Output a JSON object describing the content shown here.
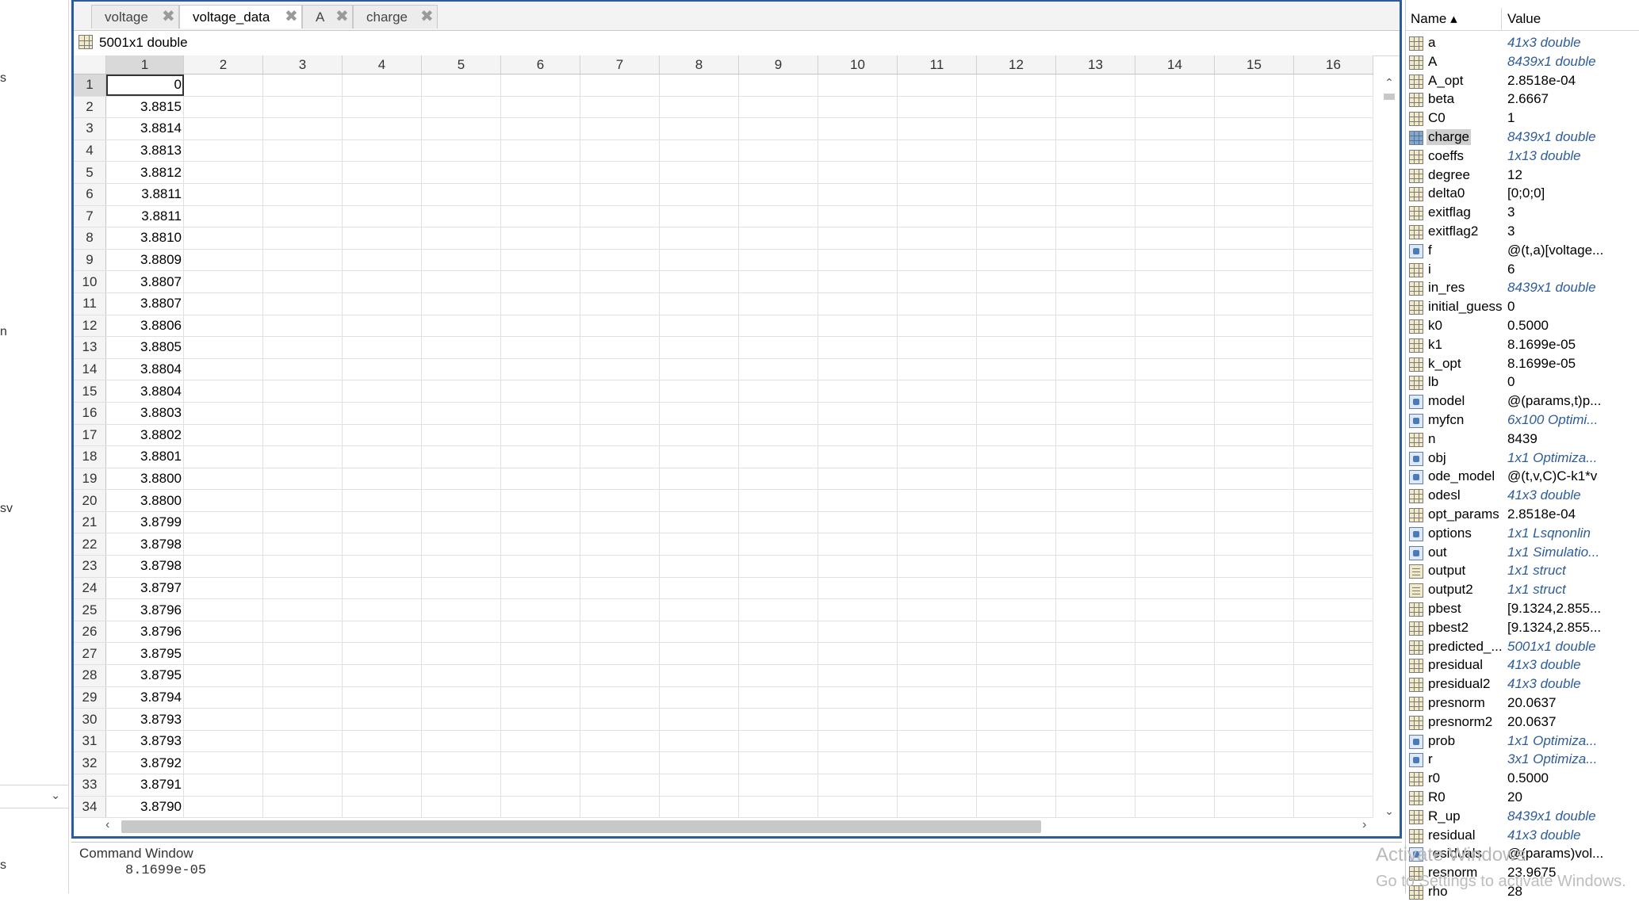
{
  "left_panel": {
    "fragments": [
      "s",
      "n",
      "sv",
      "s"
    ]
  },
  "tabs": [
    {
      "label": "voltage",
      "active": false
    },
    {
      "label": "voltage_data",
      "active": true
    },
    {
      "label": "A",
      "active": false
    },
    {
      "label": "charge",
      "active": false
    }
  ],
  "variable_info": "5001x1 double",
  "grid": {
    "columns": [
      "1",
      "2",
      "3",
      "4",
      "5",
      "6",
      "7",
      "8",
      "9",
      "10",
      "11",
      "12",
      "13",
      "14",
      "15",
      "16"
    ],
    "rows": [
      "1",
      "2",
      "3",
      "4",
      "5",
      "6",
      "7",
      "8",
      "9",
      "10",
      "11",
      "12",
      "13",
      "14",
      "15",
      "16",
      "17",
      "18",
      "19",
      "20",
      "21",
      "22",
      "23",
      "24",
      "25",
      "26",
      "27",
      "28",
      "29",
      "30",
      "31",
      "32",
      "33",
      "34"
    ],
    "values": [
      "0",
      "3.8815",
      "3.8814",
      "3.8813",
      "3.8812",
      "3.8811",
      "3.8811",
      "3.8810",
      "3.8809",
      "3.8807",
      "3.8807",
      "3.8806",
      "3.8805",
      "3.8804",
      "3.8804",
      "3.8803",
      "3.8802",
      "3.8801",
      "3.8800",
      "3.8800",
      "3.8799",
      "3.8798",
      "3.8798",
      "3.8797",
      "3.8796",
      "3.8796",
      "3.8795",
      "3.8795",
      "3.8794",
      "3.8793",
      "3.8793",
      "3.8792",
      "3.8791",
      "3.8790"
    ]
  },
  "command_window": {
    "title": "Command Window",
    "output": "8.1699e-05"
  },
  "workspace": {
    "header_name": "Name ▴",
    "header_value": "Value",
    "variables": [
      {
        "name": "a",
        "value": "41x3 double",
        "italic": true,
        "icon": "matrix"
      },
      {
        "name": "A",
        "value": "8439x1 double",
        "italic": true,
        "icon": "matrix"
      },
      {
        "name": "A_opt",
        "value": "2.8518e-04",
        "italic": false,
        "icon": "matrix"
      },
      {
        "name": "beta",
        "value": "2.6667",
        "italic": false,
        "icon": "matrix"
      },
      {
        "name": "C0",
        "value": "1",
        "italic": false,
        "icon": "matrix"
      },
      {
        "name": "charge",
        "value": "8439x1 double",
        "italic": true,
        "icon": "matrixsel",
        "selected": true
      },
      {
        "name": "coeffs",
        "value": "1x13 double",
        "italic": true,
        "icon": "matrix"
      },
      {
        "name": "degree",
        "value": "12",
        "italic": false,
        "icon": "matrix"
      },
      {
        "name": "delta0",
        "value": "[0;0;0]",
        "italic": false,
        "icon": "matrix"
      },
      {
        "name": "exitflag",
        "value": "3",
        "italic": false,
        "icon": "matrix"
      },
      {
        "name": "exitflag2",
        "value": "3",
        "italic": false,
        "icon": "matrix"
      },
      {
        "name": "f",
        "value": "@(t,a)[voltage...",
        "italic": false,
        "icon": "object"
      },
      {
        "name": "i",
        "value": "6",
        "italic": false,
        "icon": "matrix"
      },
      {
        "name": "in_res",
        "value": "8439x1 double",
        "italic": true,
        "icon": "matrix"
      },
      {
        "name": "initial_guess",
        "value": "0",
        "italic": false,
        "icon": "matrix"
      },
      {
        "name": "k0",
        "value": "0.5000",
        "italic": false,
        "icon": "matrix"
      },
      {
        "name": "k1",
        "value": "8.1699e-05",
        "italic": false,
        "icon": "matrix"
      },
      {
        "name": "k_opt",
        "value": "8.1699e-05",
        "italic": false,
        "icon": "matrix"
      },
      {
        "name": "lb",
        "value": "0",
        "italic": false,
        "icon": "matrix"
      },
      {
        "name": "model",
        "value": "@(params,t)p...",
        "italic": false,
        "icon": "object"
      },
      {
        "name": "myfcn",
        "value": "6x100 Optimi...",
        "italic": true,
        "icon": "object"
      },
      {
        "name": "n",
        "value": "8439",
        "italic": false,
        "icon": "matrix"
      },
      {
        "name": "obj",
        "value": "1x1 Optimiza...",
        "italic": true,
        "icon": "object"
      },
      {
        "name": "ode_model",
        "value": "@(t,v,C)C-k1*v",
        "italic": false,
        "icon": "object"
      },
      {
        "name": "odesl",
        "value": "41x3 double",
        "italic": true,
        "icon": "matrix"
      },
      {
        "name": "opt_params",
        "value": "2.8518e-04",
        "italic": false,
        "icon": "matrix"
      },
      {
        "name": "options",
        "value": "1x1 Lsqnonlin",
        "italic": true,
        "icon": "object"
      },
      {
        "name": "out",
        "value": "1x1 Simulatio...",
        "italic": true,
        "icon": "object"
      },
      {
        "name": "output",
        "value": "1x1 struct",
        "italic": true,
        "icon": "struct"
      },
      {
        "name": "output2",
        "value": "1x1 struct",
        "italic": true,
        "icon": "struct"
      },
      {
        "name": "pbest",
        "value": "[9.1324,2.855...",
        "italic": false,
        "icon": "matrix"
      },
      {
        "name": "pbest2",
        "value": "[9.1324,2.855...",
        "italic": false,
        "icon": "matrix"
      },
      {
        "name": "predicted_...",
        "value": "5001x1 double",
        "italic": true,
        "icon": "matrix"
      },
      {
        "name": "presidual",
        "value": "41x3 double",
        "italic": true,
        "icon": "matrix"
      },
      {
        "name": "presidual2",
        "value": "41x3 double",
        "italic": true,
        "icon": "matrix"
      },
      {
        "name": "presnorm",
        "value": "20.0637",
        "italic": false,
        "icon": "matrix"
      },
      {
        "name": "presnorm2",
        "value": "20.0637",
        "italic": false,
        "icon": "matrix"
      },
      {
        "name": "prob",
        "value": "1x1 Optimiza...",
        "italic": true,
        "icon": "object"
      },
      {
        "name": "r",
        "value": "3x1 Optimiza...",
        "italic": true,
        "icon": "object"
      },
      {
        "name": "r0",
        "value": "0.5000",
        "italic": false,
        "icon": "matrix"
      },
      {
        "name": "R0",
        "value": "20",
        "italic": false,
        "icon": "matrix"
      },
      {
        "name": "R_up",
        "value": "8439x1 double",
        "italic": true,
        "icon": "matrix"
      },
      {
        "name": "residual",
        "value": "41x3 double",
        "italic": true,
        "icon": "matrix"
      },
      {
        "name": "residuals",
        "value": "@(params)vol...",
        "italic": false,
        "icon": "object"
      },
      {
        "name": "resnorm",
        "value": "23.9675",
        "italic": false,
        "icon": "matrix"
      },
      {
        "name": "rho",
        "value": "28",
        "italic": false,
        "icon": "matrix"
      }
    ]
  },
  "watermark": {
    "line1": "Activate Windows",
    "line2": "Go to Settings to activate Windows."
  }
}
